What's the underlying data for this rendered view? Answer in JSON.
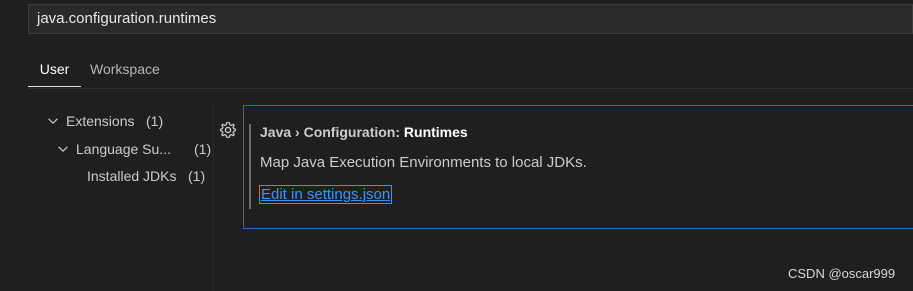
{
  "search": {
    "value": "java.configuration.runtimes"
  },
  "tabs": [
    {
      "label": "User",
      "active": true
    },
    {
      "label": "Workspace",
      "active": false
    }
  ],
  "tree": {
    "items": [
      {
        "label": "Extensions",
        "count": "(1)",
        "expanded": true
      },
      {
        "label": "Language Su...",
        "count": "(1)",
        "expanded": true
      },
      {
        "label": "Installed JDKs",
        "count": "(1)"
      }
    ]
  },
  "setting": {
    "category": "Java › Configuration: ",
    "name": "Runtimes",
    "description": "Map Java Execution Environments to local JDKs.",
    "link": "Edit in settings.json"
  },
  "watermark": "CSDN @oscar999",
  "colors": {
    "accent": "#3794ff",
    "focus_border": "#1f6fbf",
    "background": "#1f1f1f"
  },
  "icons": {
    "chevron": "chevron-down-icon",
    "gear": "gear-icon"
  }
}
